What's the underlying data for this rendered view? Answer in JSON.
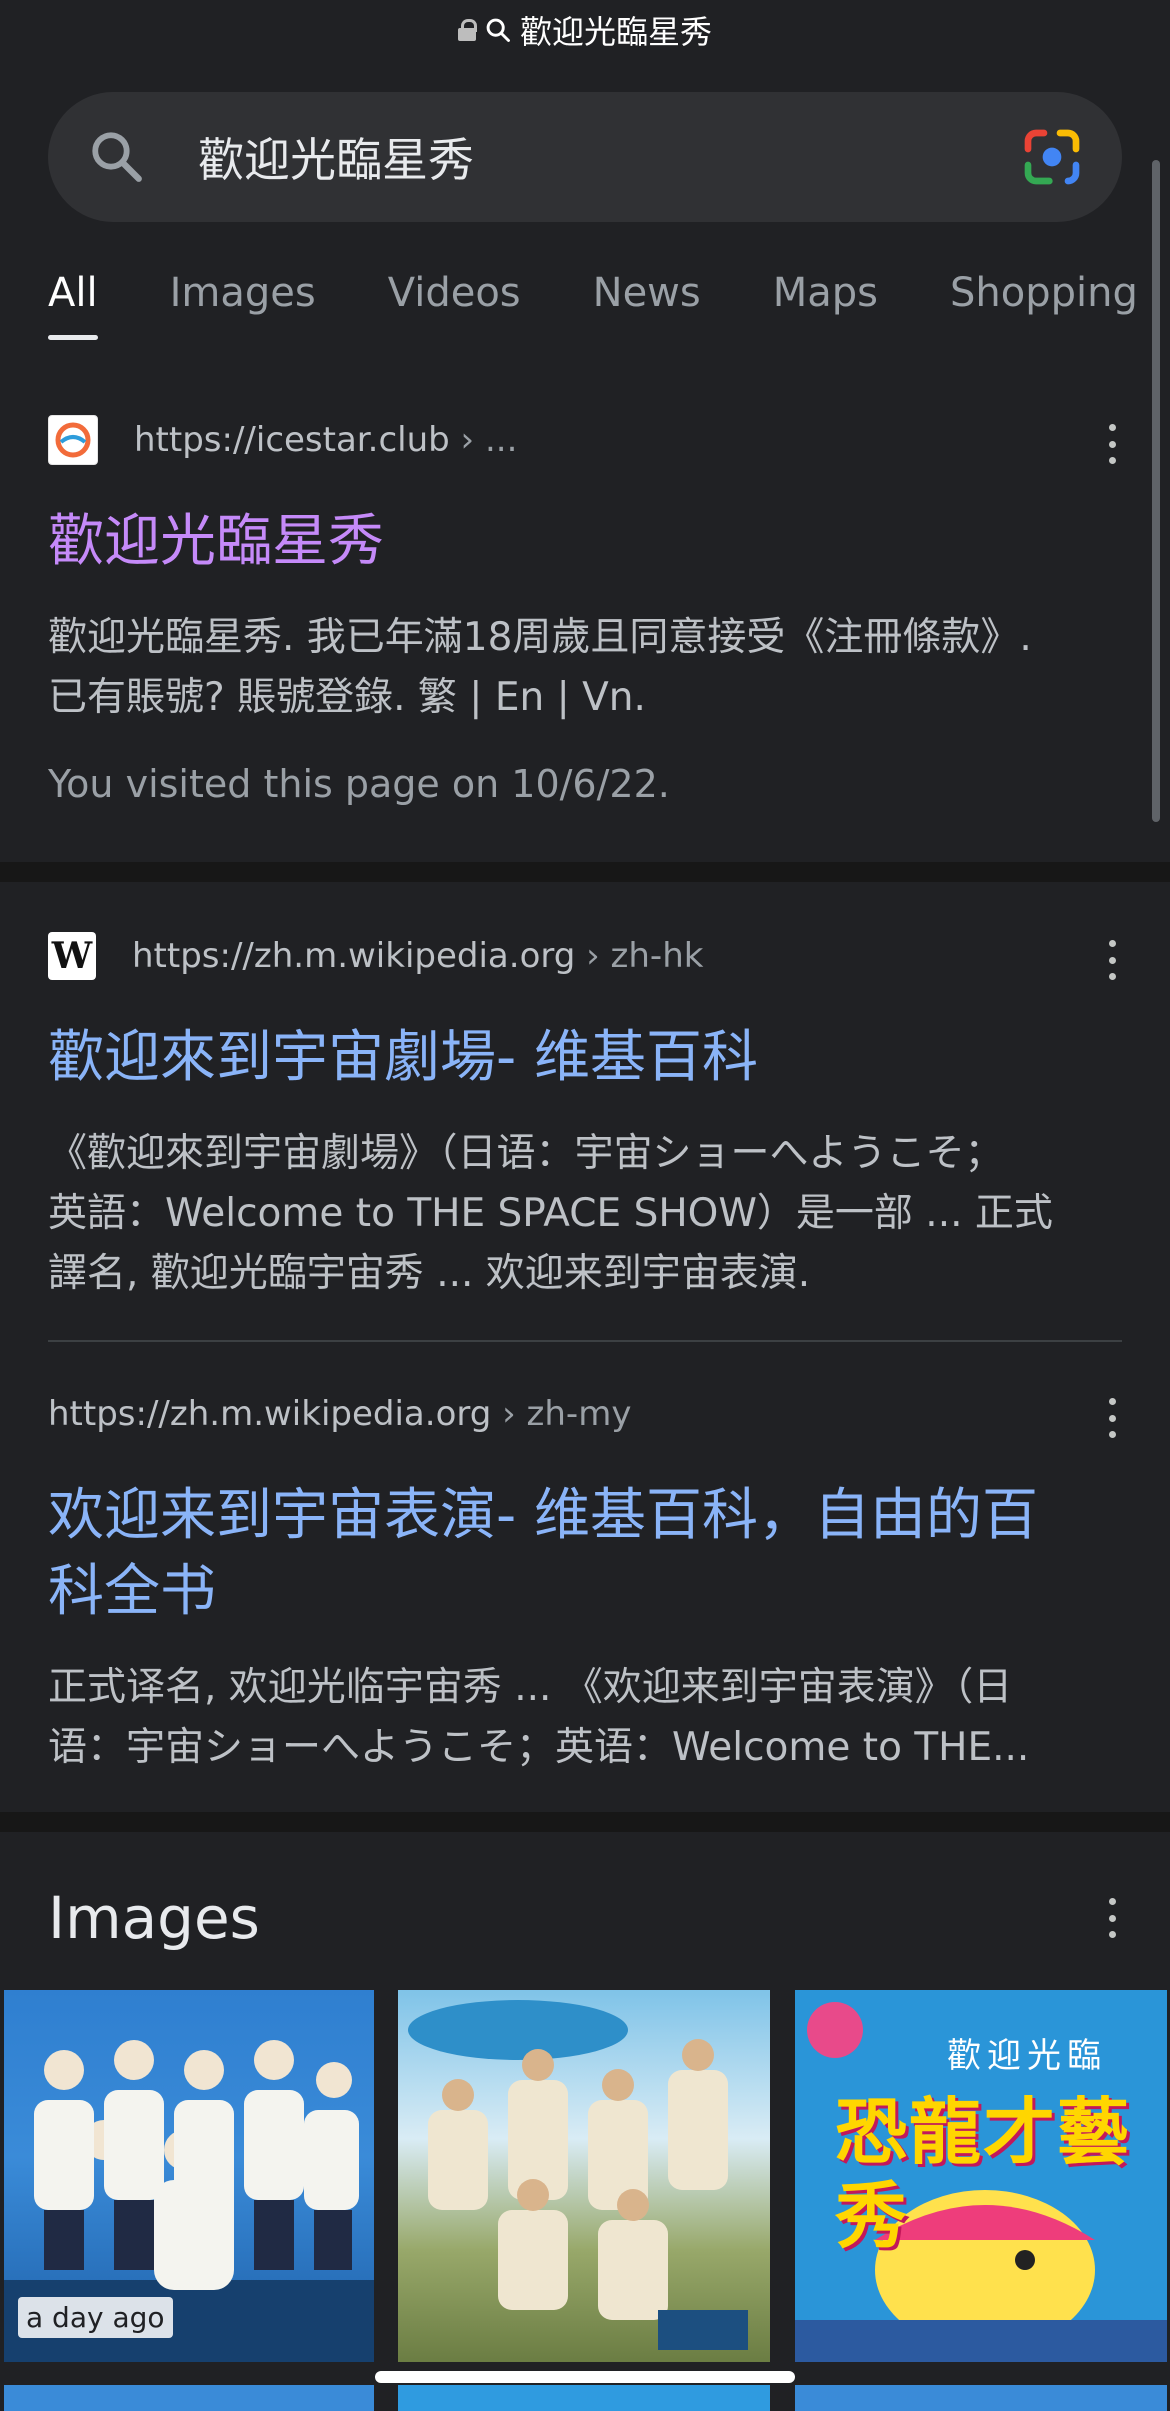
{
  "urlbar": {
    "text": "歡迎光臨星秀"
  },
  "search": {
    "query": "歡迎光臨星秀"
  },
  "tabs": [
    {
      "label": "All",
      "active": true
    },
    {
      "label": "Images",
      "active": false
    },
    {
      "label": "Videos",
      "active": false
    },
    {
      "label": "News",
      "active": false
    },
    {
      "label": "Maps",
      "active": false
    },
    {
      "label": "Shopping",
      "active": false
    }
  ],
  "results": [
    {
      "host": "https://icestar.club",
      "path": " › ...",
      "title": "歡迎光臨星秀",
      "snippet_line1": "歡迎光臨星秀. 我已年滿18周歲且同意接受《注冊條款》.",
      "snippet_line2": "已有賬號? 賬號登錄. 繁 | En | Vn.",
      "visited_note": "You visited this page on 10/6/22."
    },
    {
      "host": "https://zh.m.wikipedia.org",
      "path": " › zh-hk",
      "favicon_letter": "W",
      "title": "歡迎來到宇宙劇場- 维基百科",
      "snippet_line1": "《歡迎來到宇宙劇場》（日语：宇宙ショーへようこそ；",
      "snippet_line2": "英語：Welcome to THE SPACE SHOW）是一部 ... 正式",
      "snippet_line3": "譯名, 歡迎光臨宇宙秀 ... 欢迎来到宇宙表演."
    },
    {
      "host": "https://zh.m.wikipedia.org",
      "path": " › zh-my",
      "title_line1": "欢迎来到宇宙表演- 维基百科，自由的百",
      "title_line2": "科全书",
      "snippet_line1": "正式译名, 欢迎光临宇宙秀 ... 《欢迎来到宇宙表演》（日",
      "snippet_line2": "语：宇宙ショーへようこそ；英语：Welcome to THE..."
    }
  ],
  "images": {
    "heading": "Images",
    "thumb1_badge": "a day ago",
    "thumb3_top": "歡迎光臨",
    "thumb3_title": "恐龍才藝秀"
  },
  "colors": {
    "background": "#202124",
    "visited_link": "#c58af9",
    "link": "#8ab4f8"
  }
}
